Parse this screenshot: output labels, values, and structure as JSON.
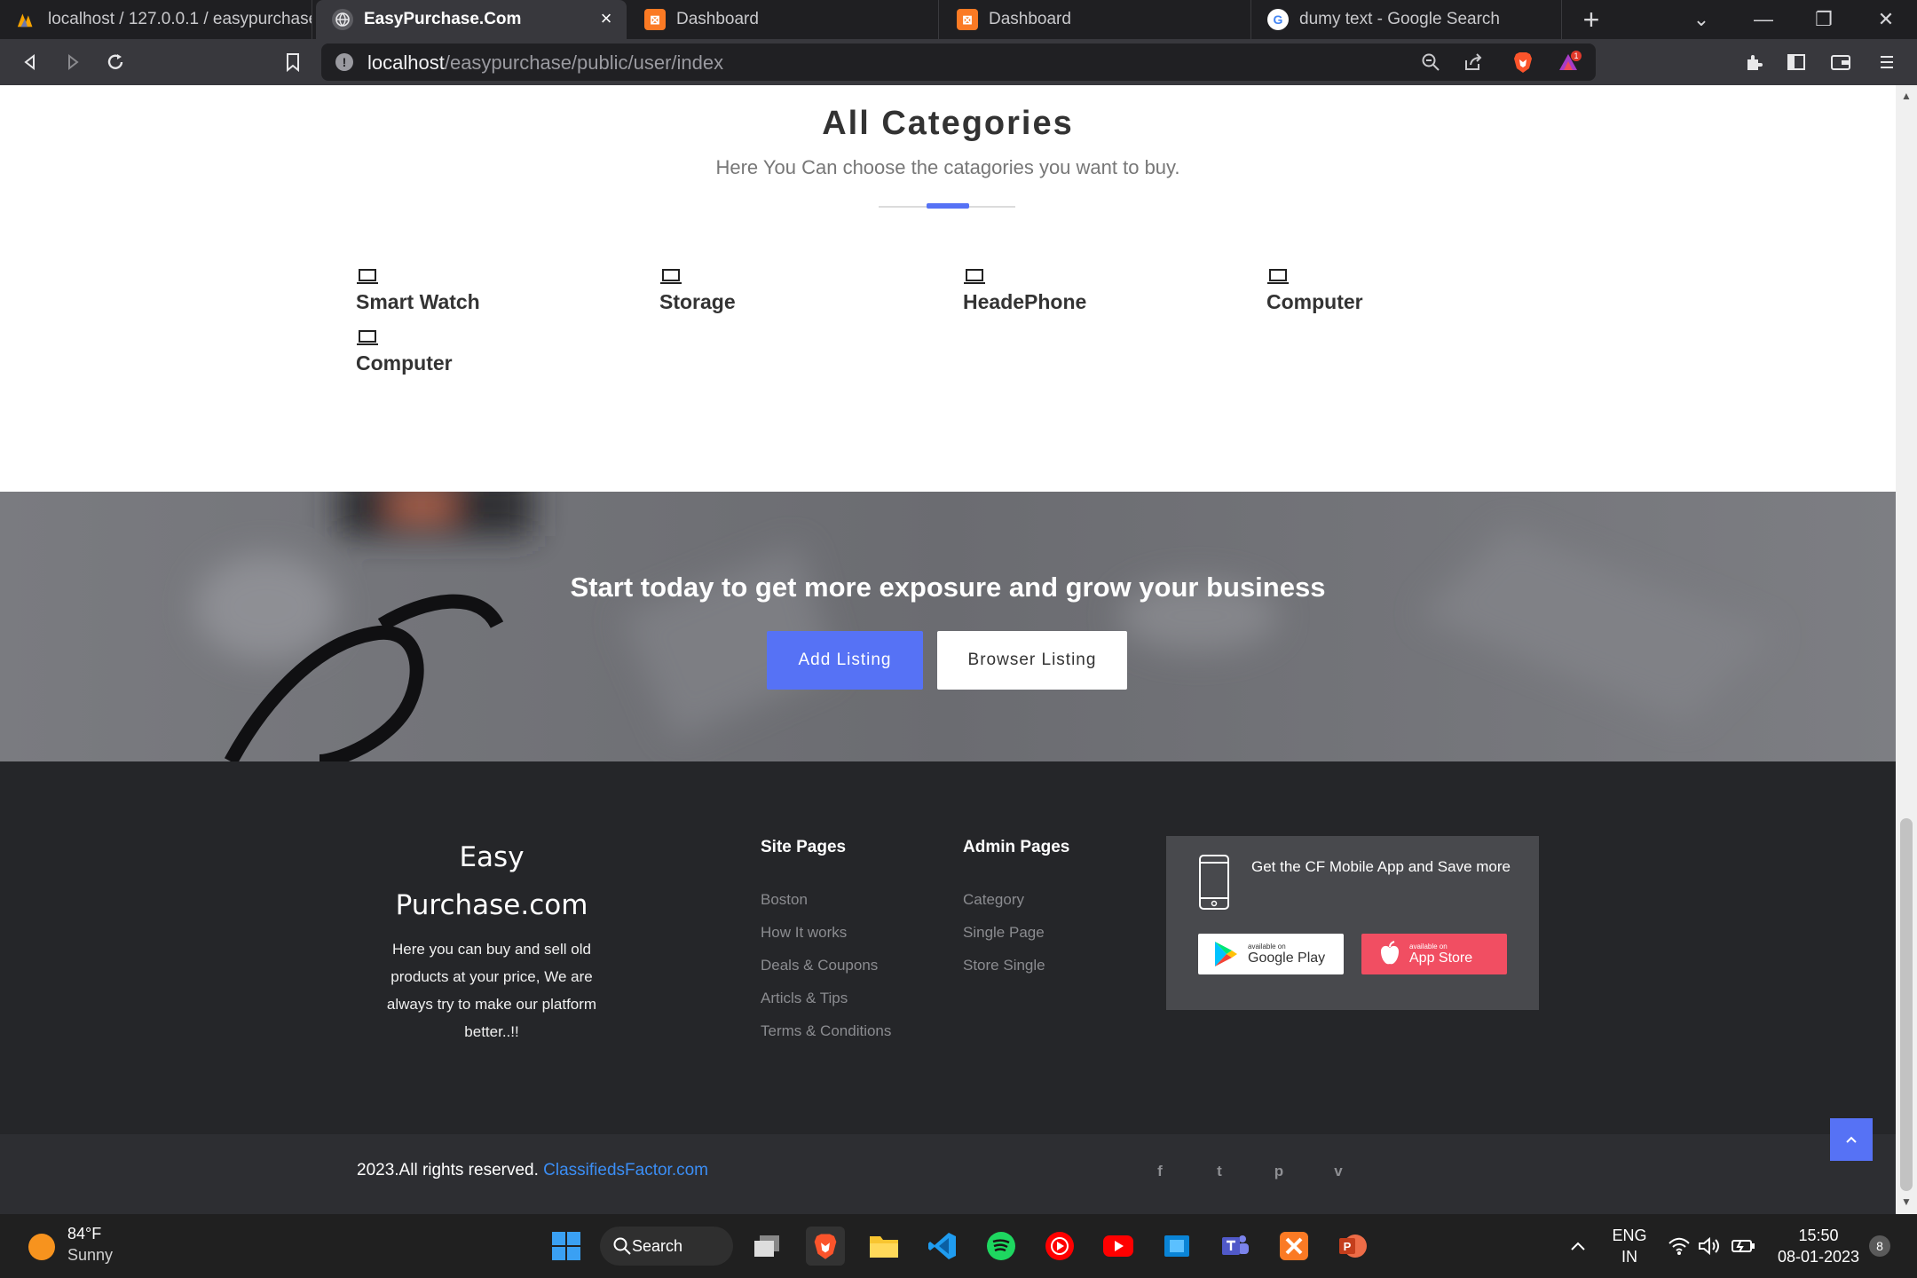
{
  "browser": {
    "tabs": [
      {
        "title": "localhost / 127.0.0.1 / easypurchase /",
        "icon": "phpmyadmin-icon"
      },
      {
        "title": "EasyPurchase.Com",
        "icon": "globe-icon",
        "active": true
      },
      {
        "title": "Dashboard",
        "icon": "xampp-icon"
      },
      {
        "title": "Dashboard",
        "icon": "xampp-icon"
      },
      {
        "title": "dumy text - Google Search",
        "icon": "google-icon"
      }
    ],
    "url_host": "localhost",
    "url_path": "/easypurchase/public/user/index",
    "rewards_badge": "1"
  },
  "categories_section": {
    "title": "All Categories",
    "subtitle": "Here You Can choose the catagories you want to buy.",
    "items": [
      {
        "label": "Smart Watch",
        "icon": "laptop-icon"
      },
      {
        "label": "Storage",
        "icon": "laptop-icon"
      },
      {
        "label": "HeadePhone",
        "icon": "laptop-icon"
      },
      {
        "label": "Computer",
        "icon": "laptop-icon"
      },
      {
        "label": "Computer",
        "icon": "laptop-icon"
      }
    ],
    "accent_color": "#5672f5"
  },
  "cta": {
    "title": "Start today to get more exposure and grow your business",
    "add_listing": "Add Listing",
    "browse_listing": "Browser Listing"
  },
  "footer": {
    "brand_line1": "Easy",
    "brand_line2": "Purchase.com",
    "brand_desc": "Here you can buy and sell old products at your price, We are always try to make our platform better..!!",
    "site_pages": {
      "title": "Site Pages",
      "links": [
        "Boston",
        "How It works",
        "Deals & Coupons",
        "Articls & Tips",
        "Terms & Conditions"
      ]
    },
    "admin_pages": {
      "title": "Admin Pages",
      "links": [
        "Category",
        "Single Page",
        "Store Single"
      ]
    },
    "app": {
      "text": "Get the CF Mobile App and Save more",
      "google_small": "available on",
      "google_large": "Google Play",
      "apple_small": "available on",
      "apple_large": "App Store"
    },
    "copyright": "2023.All rights reserved.",
    "copyright_link": "ClassifiedsFactor.com",
    "social": [
      "f",
      "t",
      "p",
      "v"
    ]
  },
  "taskbar": {
    "temperature": "84°F",
    "condition": "Sunny",
    "search": "Search",
    "lang1": "ENG",
    "lang2": "IN",
    "time": "15:50",
    "date": "08-01-2023",
    "notifications": "8"
  }
}
